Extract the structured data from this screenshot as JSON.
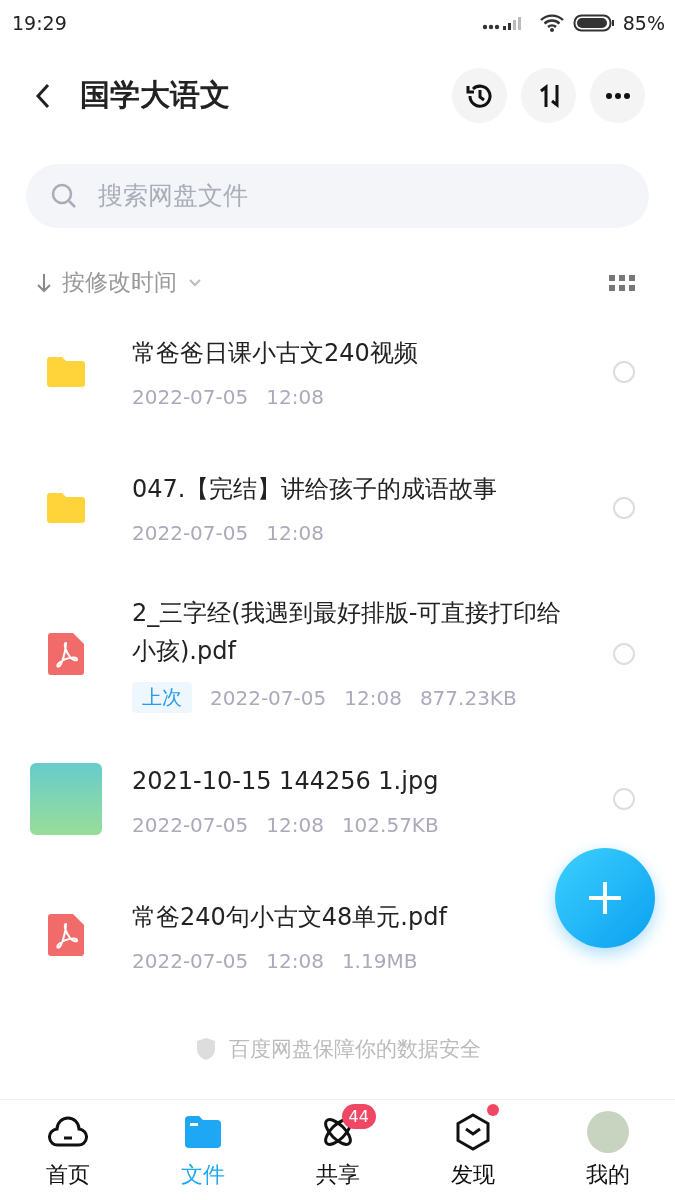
{
  "status_bar": {
    "time": "19:29",
    "battery": "85%"
  },
  "header": {
    "title": "国学大语文"
  },
  "search": {
    "placeholder": "搜索网盘文件"
  },
  "sort": {
    "label": "按修改时间"
  },
  "files": [
    {
      "kind": "folder",
      "name": "常爸爸日课小古文240视频",
      "date": "2022-07-05",
      "time": "12:08",
      "selected": false
    },
    {
      "kind": "folder",
      "name": "047.【完结】讲给孩子的成语故事",
      "date": "2022-07-05",
      "time": "12:08",
      "selected": false
    },
    {
      "kind": "pdf",
      "name": "2_三字经(我遇到最好排版-可直接打印给小孩).pdf",
      "tag": "上次",
      "date": "2022-07-05",
      "time": "12:08",
      "size": "877.23KB",
      "selected": false
    },
    {
      "kind": "image",
      "name": "2021-10-15 144256 1.jpg",
      "date": "2022-07-05",
      "time": "12:08",
      "size": "102.57KB",
      "selected": false
    },
    {
      "kind": "pdf",
      "name": "常爸240句小古文48单元.pdf",
      "date": "2022-07-05",
      "time": "12:08",
      "size": "1.19MB"
    }
  ],
  "footer_note": "百度网盘保障你的数据安全",
  "nav": [
    {
      "kind": "home",
      "label": "首页",
      "selected": false
    },
    {
      "kind": "files",
      "label": "文件",
      "selected": true
    },
    {
      "kind": "share",
      "label": "共享",
      "selected": false,
      "badge": "44"
    },
    {
      "kind": "discover",
      "label": "发现",
      "selected": false,
      "dot": true
    },
    {
      "kind": "me",
      "label": "我的",
      "selected": false
    }
  ]
}
